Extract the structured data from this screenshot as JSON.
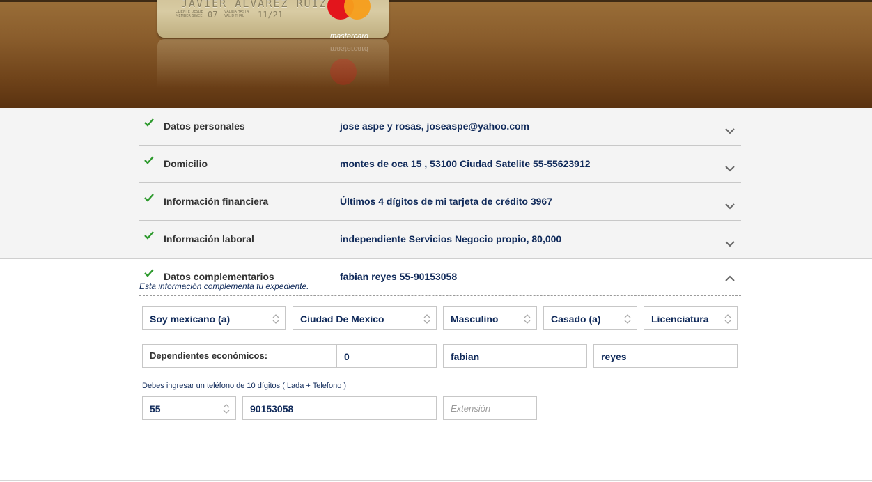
{
  "card": {
    "holder_name": "JAVIER ALVAREZ RUIZ",
    "member_since_label": "CLIENTE DESDE MEMBER SINCE",
    "member_since": "07",
    "valid_thru_label": "VÁLIDA HASTA VALID THRU",
    "valid_thru": "11/21",
    "brand": "mastercard"
  },
  "sections": [
    {
      "title": "Datos personales",
      "value": "jose aspe y rosas, joseaspe@yahoo.com",
      "status": "complete",
      "expanded": false
    },
    {
      "title": "Domicilio",
      "value": "montes de oca 15 , 53100 Ciudad Satelite 55-55623912",
      "status": "complete",
      "expanded": false
    },
    {
      "title": "Información financiera",
      "value": "Últimos 4 dígitos de mi tarjeta de crédito 3967",
      "status": "complete",
      "expanded": false
    },
    {
      "title": "Información laboral",
      "value": "independiente Servicios Negocio propio, 80,000",
      "status": "complete",
      "expanded": false
    }
  ],
  "active_section": {
    "title": "Datos complementarios",
    "value": "fabian reyes 55-90153058",
    "note": "Esta información complementa tu expediente.",
    "status": "complete",
    "expanded": true
  },
  "form": {
    "nationality": "Soy mexicano (a)",
    "state": "Ciudad De Mexico",
    "gender": "Masculino",
    "marital_status": "Casado (a)",
    "education": "Licenciatura",
    "dependents_label": "Dependientes económicos:",
    "dependents_value": "0",
    "reference_first_name": "fabian",
    "reference_last_name": "reyes",
    "phone_note": "Debes ingresar un teléfono de 10 dígitos ( Lada + Telefono )",
    "lada": "55",
    "phone": "90153058",
    "extension_placeholder": "Extensión"
  },
  "colors": {
    "check": "#2e9a2e",
    "value_text": "#102a5a",
    "hero_brown": "#7a4c20"
  }
}
